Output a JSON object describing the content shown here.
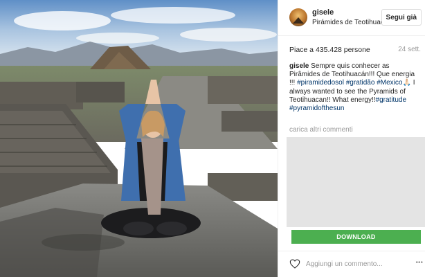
{
  "post": {
    "username": "gisele",
    "location": "Pirámides de Teotihuacán",
    "follow_label": "Segui già",
    "likes_text": "Piace a 435.428 persone",
    "date": "24 sett.",
    "more_comments": "carica altri commenti",
    "caption": {
      "user": "gisele",
      "text_a": " Sempre quis conhecer as Pirâmides de Teotihuacán!!! Que energia !!! ",
      "tag1": "#piramidedosol",
      "text_b": " ",
      "tag2": "#gratidão",
      "text_c": " ",
      "tag3": "#Mexico",
      "mute": "🙏🏻",
      "text_d": " I always wanted to see the Pyramids of Teotihuacan!! What energy!!",
      "tag4": "#gratitude",
      "text_e": " ",
      "tag5": "#pyramidofthesun"
    },
    "download_label": "DOWNLOAD",
    "comment_placeholder": "Aggiungi un commento...",
    "more_label": "•••"
  },
  "icons": {
    "avatar": "profile-avatar",
    "heart": "heart-icon",
    "more": "more-options-icon"
  },
  "colors": {
    "download": "#4caf50",
    "hashtag": "#003569",
    "muted": "#999999"
  }
}
